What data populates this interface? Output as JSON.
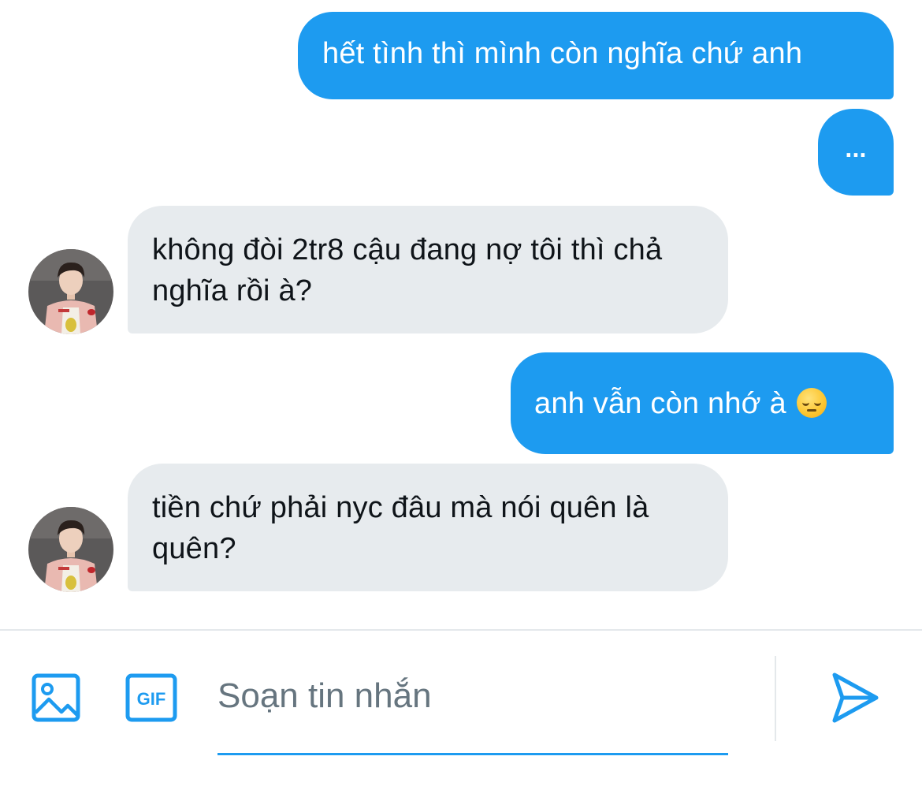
{
  "messages": [
    {
      "direction": "sent",
      "text": "hết tình thì mình còn nghĩa chứ anh"
    },
    {
      "direction": "sent",
      "text": "..."
    },
    {
      "direction": "received",
      "text": "không đòi 2tr8 cậu đang nợ tôi thì chả nghĩa rồi à?"
    },
    {
      "direction": "sent",
      "text": "anh vẫn còn nhớ à",
      "emoji": "pensive-face"
    },
    {
      "direction": "received",
      "text": "tiền chứ phải nyc đâu mà nói quên là quên?"
    }
  ],
  "composer": {
    "placeholder": "Soạn tin nhắn",
    "gif_label": "GIF",
    "icons": [
      "image-icon",
      "gif-icon",
      "send-icon"
    ]
  },
  "colors": {
    "accent": "#1d9bf0",
    "received_bubble": "#e7ebee",
    "received_text": "#0f1419",
    "placeholder_text": "#66757f"
  }
}
